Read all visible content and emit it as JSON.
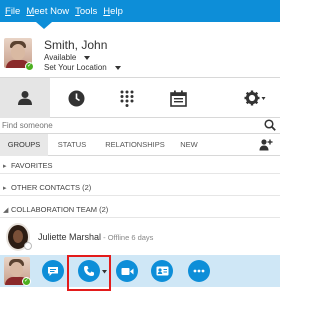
{
  "menu": {
    "file": "File",
    "meet_now": "Meet Now",
    "tools": "Tools",
    "help": "Help"
  },
  "profile": {
    "name": "Smith, John",
    "status": "Available",
    "location": "Set Your Location"
  },
  "nav_tabs": [
    "contacts-tab",
    "history-tab",
    "dialpad-tab",
    "meetings-tab",
    "options-tab"
  ],
  "search": {
    "placeholder": "Find someone"
  },
  "subtabs": {
    "groups": "GROUPS",
    "status": "STATUS",
    "relationships": "RELATIONSHIPS",
    "new": "NEW"
  },
  "groups": {
    "favorites": "FAVORITES",
    "other_contacts": "OTHER CONTACTS (2)",
    "collaboration_team": "COLLABORATION TEAM (2)"
  },
  "contact": {
    "name": "Juliette Marshal",
    "status": " - Offline 6 days"
  },
  "actions": [
    "im-button",
    "call-button",
    "video-button",
    "contact-card-button",
    "more-button"
  ],
  "colors": {
    "accent": "#0d8ed8",
    "action_bar": "#cfe7f6",
    "available": "#4caf20",
    "highlight": "#e31b1b"
  }
}
